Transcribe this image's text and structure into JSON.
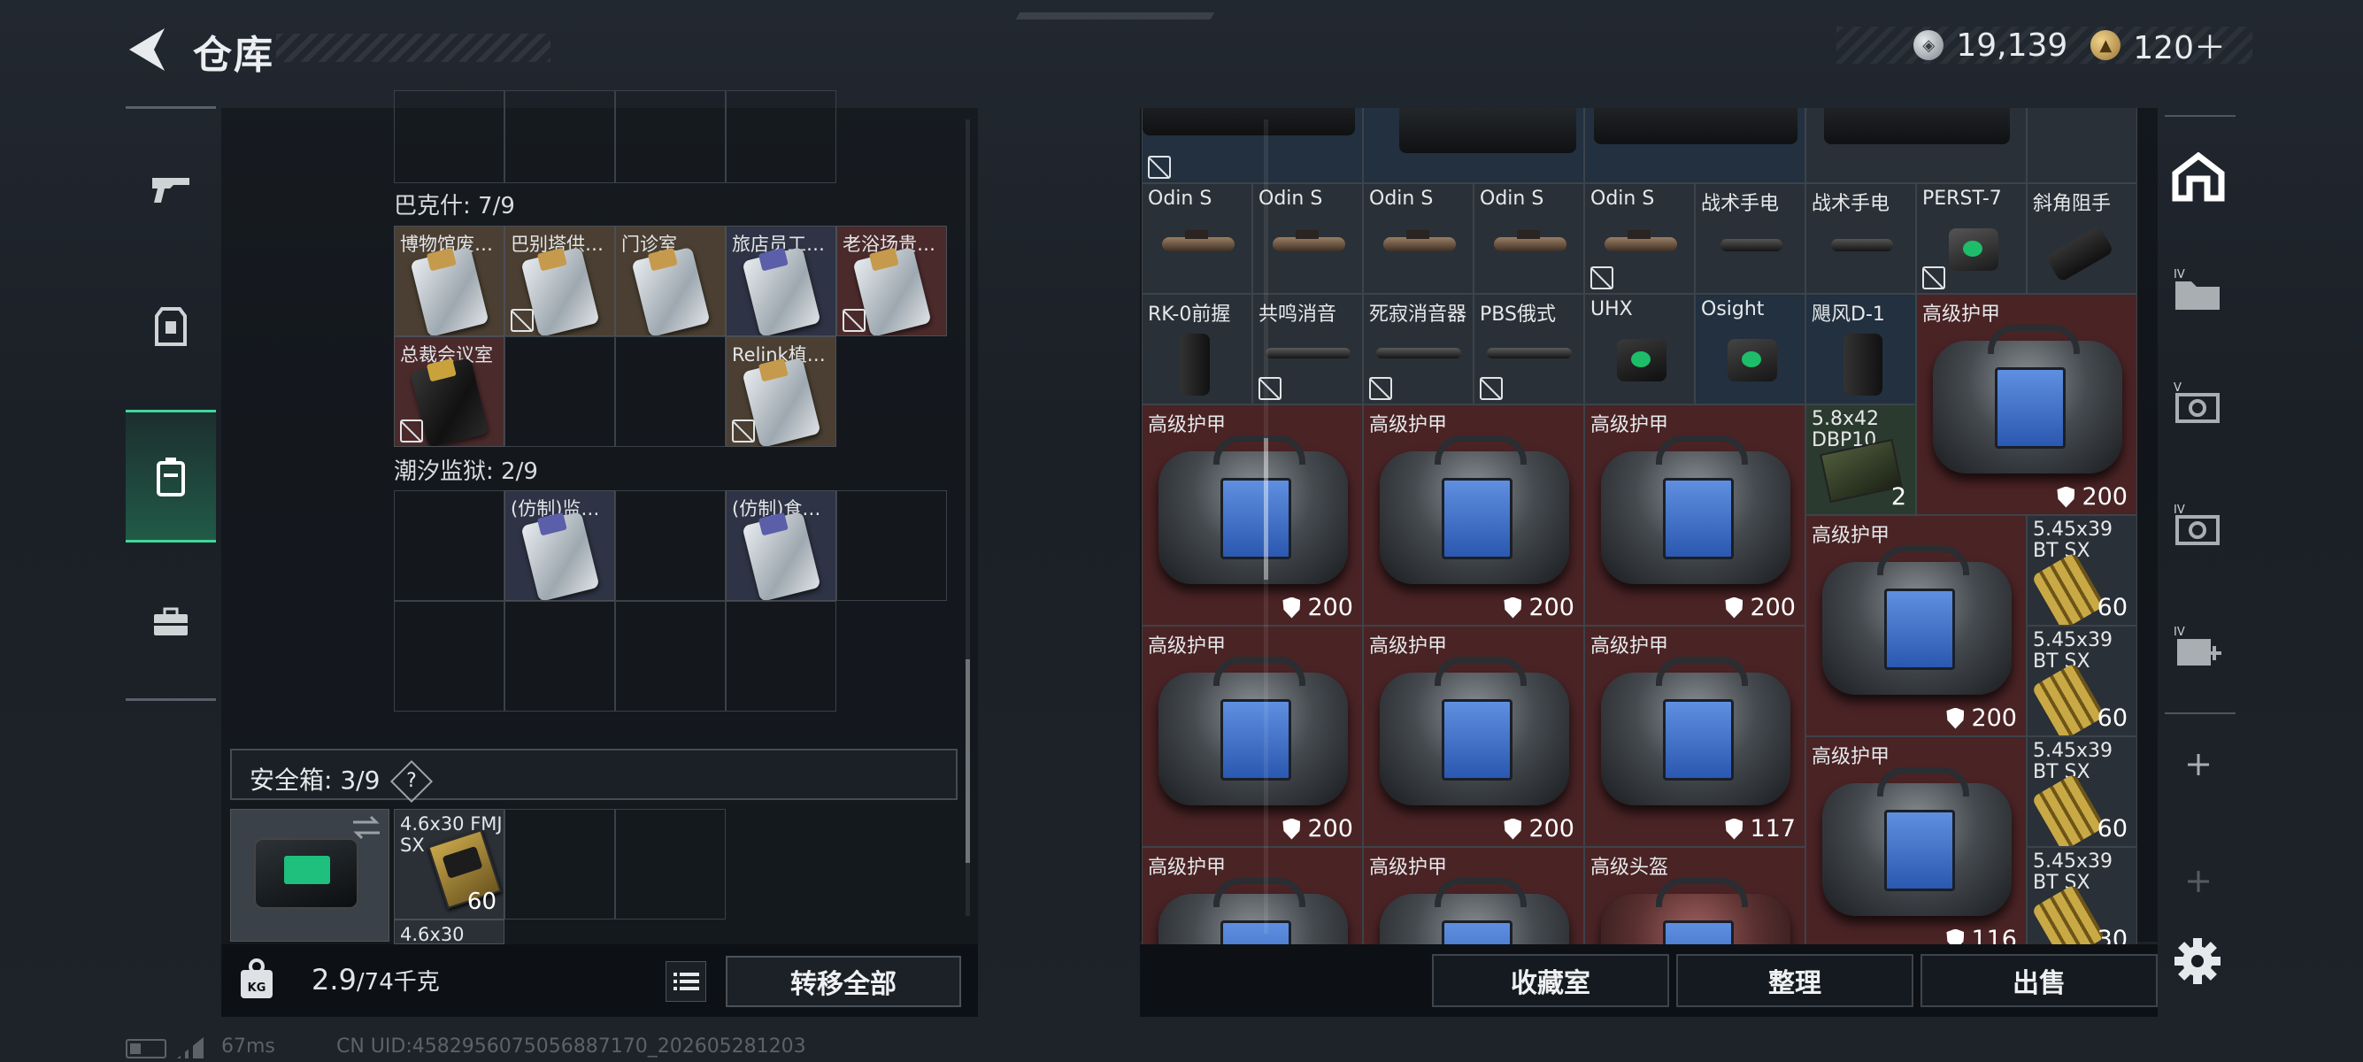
{
  "header": {
    "title": "仓库"
  },
  "currency": {
    "silver": "19,139",
    "gold": "120＋"
  },
  "left": {
    "sections": [
      {
        "label": "巴克什: 7/9",
        "items": [
          {
            "name": "博物馆废…",
            "locked": false
          },
          {
            "name": "巴别塔供…",
            "locked": true
          },
          {
            "name": "门诊室",
            "locked": false
          },
          {
            "name": "旅店员工…",
            "locked": false
          },
          {
            "name": "老浴场贵…",
            "locked": true
          },
          {
            "name": "总裁会议室",
            "locked": true
          },
          {
            "name": "Relink植…",
            "locked": true
          }
        ]
      },
      {
        "label": "潮汐监狱: 2/9",
        "items": [
          {
            "name": "(仿制)监…",
            "locked": false
          },
          {
            "name": "(仿制)食…",
            "locked": false
          }
        ]
      }
    ],
    "safebox": {
      "label": "安全箱: 3/9",
      "help": "?",
      "ammo_name": "4.6x30 FMJ SX",
      "ammo_qty": "60",
      "ammo_name2": "4.6x30"
    },
    "weight": {
      "current": "2.9",
      "max": "/74千克"
    },
    "transfer_all": "转移全部"
  },
  "right": {
    "row1": [
      {
        "name": "Odin S"
      },
      {
        "name": "Odin S"
      },
      {
        "name": "Odin S"
      },
      {
        "name": "Odin S"
      },
      {
        "name": "Odin S"
      },
      {
        "name": "战术手电"
      },
      {
        "name": "战术手电"
      },
      {
        "name": "PERST-7"
      },
      {
        "name": "斜角阻手"
      }
    ],
    "row2": [
      {
        "name": "RK-0前握"
      },
      {
        "name": "共鸣消音"
      },
      {
        "name": "死寂消音器"
      },
      {
        "name": "PBS俄式"
      },
      {
        "name": "UHX"
      },
      {
        "name": "Osight"
      },
      {
        "name": "飓风D-1"
      }
    ],
    "armor_name": "高级护甲",
    "helmet_name": "高级头盔",
    "armor_values": [
      "200",
      "200",
      "200",
      "200",
      "200",
      "200",
      "200",
      "200",
      "117",
      "200",
      "116"
    ],
    "ammo_box": {
      "name": "5.8x42 DBP10",
      "qty": "2"
    },
    "ammo_545": {
      "name": "5.45x39 BT SX",
      "qtys": [
        "60",
        "60",
        "60",
        "30"
      ]
    },
    "buttons": {
      "collection": "收藏室",
      "sort": "整理",
      "sell": "出售"
    }
  },
  "status": {
    "ping": "67ms",
    "uid": "CN UID:4582956075056887170_202605281203"
  },
  "colors": {
    "accent": "#3fd89a",
    "armor_bg": "#4a2325",
    "blue_bg": "#22303f"
  }
}
